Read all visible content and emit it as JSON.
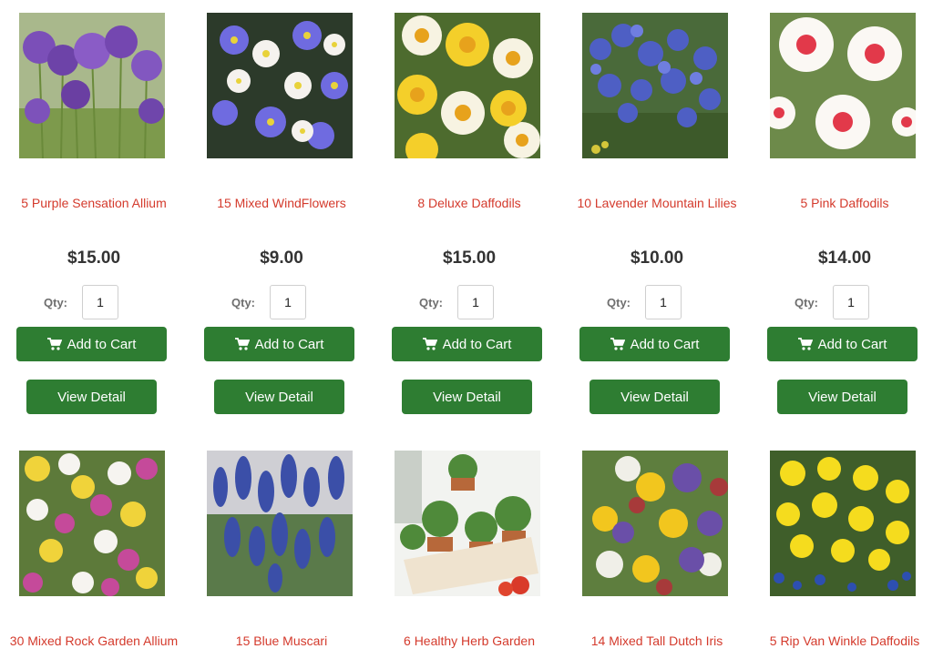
{
  "qty_label": "Qty:",
  "add_to_cart_label": "Add to Cart",
  "view_detail_label": "View Detail",
  "colors": {
    "accent_green": "#2e7d32",
    "product_name": "#d43a2c",
    "price_text": "#333333"
  },
  "products": [
    {
      "name": "5 Purple Sensation Allium",
      "price": "$15.00",
      "qty": "1",
      "image": "purple-allium-photo"
    },
    {
      "name": "15 Mixed WindFlowers",
      "price": "$9.00",
      "qty": "1",
      "image": "windflowers-photo"
    },
    {
      "name": "8 Deluxe Daffodils",
      "price": "$15.00",
      "qty": "1",
      "image": "deluxe-daffodils-photo"
    },
    {
      "name": "10 Lavender Mountain Lilies",
      "price": "$10.00",
      "qty": "1",
      "image": "lavender-lilies-photo"
    },
    {
      "name": "5 Pink Daffodils",
      "price": "$14.00",
      "qty": "1",
      "image": "pink-daffodils-photo"
    },
    {
      "name": "30 Mixed Rock Garden Allium",
      "image": "rock-garden-allium-photo"
    },
    {
      "name": "15 Blue Muscari",
      "image": "blue-muscari-photo"
    },
    {
      "name": "6 Healthy Herb Garden",
      "image": "herb-garden-photo"
    },
    {
      "name": "14 Mixed Tall Dutch Iris",
      "image": "dutch-iris-photo"
    },
    {
      "name": "5 Rip Van Winkle Daffodils",
      "image": "rip-van-winkle-photo"
    }
  ]
}
